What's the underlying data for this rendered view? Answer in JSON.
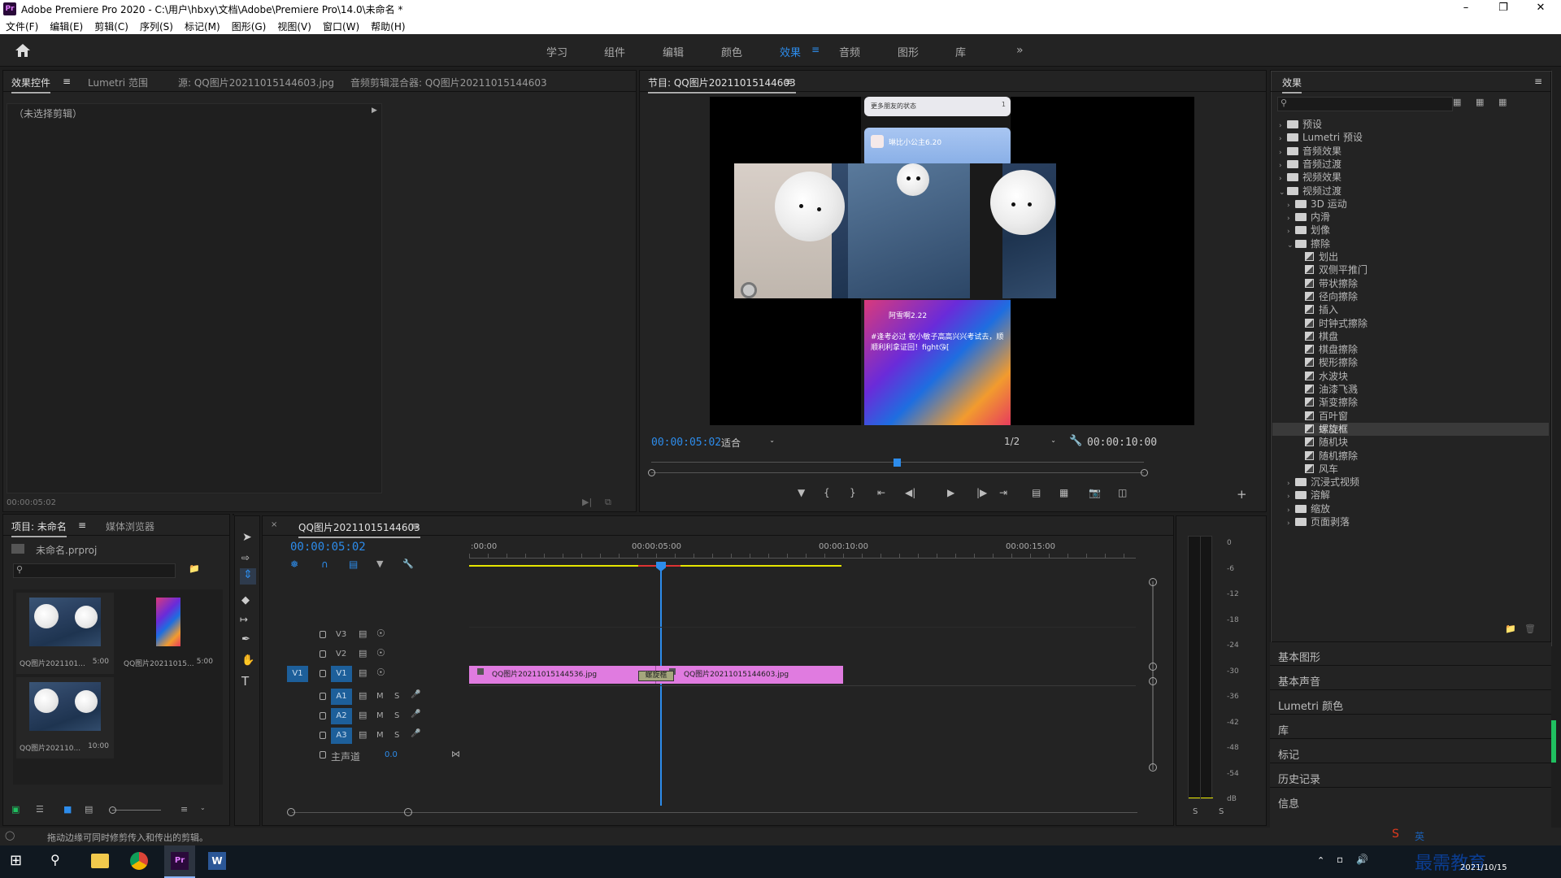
{
  "window": {
    "title": "Adobe Premiere Pro 2020 - C:\\用户\\hbxy\\文档\\Adobe\\Premiere Pro\\14.0\\未命名 *",
    "app_icon": "Pr"
  },
  "menu": [
    "文件(F)",
    "编辑(E)",
    "剪辑(C)",
    "序列(S)",
    "标记(M)",
    "图形(G)",
    "视图(V)",
    "窗口(W)",
    "帮助(H)"
  ],
  "workspaces": [
    "学习",
    "组件",
    "编辑",
    "颜色",
    "效果",
    "音频",
    "图形",
    "库"
  ],
  "workspace_active": "效果",
  "source_panel": {
    "tabs": [
      "效果控件",
      "Lumetri 范围",
      "源: QQ图片20211015144603.jpg",
      "音频剪辑混合器: QQ图片20211015144603"
    ],
    "no_clip": "（未选择剪辑）",
    "timecode": "00:00:05:02"
  },
  "program": {
    "tab": "节目: QQ图片20211015144603",
    "timecode": "00:00:05:02",
    "fit": "适合",
    "resolution": "1/2",
    "duration": "00:00:10:00",
    "overlay": {
      "more_friends": "更多朋友的状态",
      "more_count": "1",
      "friend_name": "琳比小公主6.20",
      "post_user": "阿雪啊2.22",
      "post_text": "#逢考必过  祝小敏子高高兴兴考试去，顺顺利利拿证回！fight😘["
    }
  },
  "effects_panel": {
    "title": "效果",
    "tree": [
      {
        "label": "预设",
        "type": "folder",
        "level": 0,
        "expanded": false
      },
      {
        "label": "Lumetri 预设",
        "type": "folder",
        "level": 0,
        "expanded": false
      },
      {
        "label": "音频效果",
        "type": "folder",
        "level": 0,
        "expanded": false
      },
      {
        "label": "音频过渡",
        "type": "folder",
        "level": 0,
        "expanded": false
      },
      {
        "label": "视频效果",
        "type": "folder",
        "level": 0,
        "expanded": false
      },
      {
        "label": "视频过渡",
        "type": "folder",
        "level": 0,
        "expanded": true
      },
      {
        "label": "3D 运动",
        "type": "folder",
        "level": 1,
        "expanded": false
      },
      {
        "label": "内滑",
        "type": "folder",
        "level": 1,
        "expanded": false
      },
      {
        "label": "划像",
        "type": "folder",
        "level": 1,
        "expanded": false
      },
      {
        "label": "擦除",
        "type": "folder",
        "level": 1,
        "expanded": true
      },
      {
        "label": "划出",
        "type": "fx",
        "level": 2
      },
      {
        "label": "双侧平推门",
        "type": "fx",
        "level": 2
      },
      {
        "label": "带状擦除",
        "type": "fx",
        "level": 2
      },
      {
        "label": "径向擦除",
        "type": "fx",
        "level": 2
      },
      {
        "label": "插入",
        "type": "fx",
        "level": 2
      },
      {
        "label": "时钟式擦除",
        "type": "fx",
        "level": 2
      },
      {
        "label": "棋盘",
        "type": "fx",
        "level": 2
      },
      {
        "label": "棋盘擦除",
        "type": "fx",
        "level": 2
      },
      {
        "label": "楔形擦除",
        "type": "fx",
        "level": 2
      },
      {
        "label": "水波块",
        "type": "fx",
        "level": 2
      },
      {
        "label": "油漆飞溅",
        "type": "fx",
        "level": 2
      },
      {
        "label": "渐变擦除",
        "type": "fx",
        "level": 2
      },
      {
        "label": "百叶窗",
        "type": "fx",
        "level": 2
      },
      {
        "label": "螺旋框",
        "type": "fx",
        "level": 2,
        "selected": true
      },
      {
        "label": "随机块",
        "type": "fx",
        "level": 2
      },
      {
        "label": "随机擦除",
        "type": "fx",
        "level": 2
      },
      {
        "label": "风车",
        "type": "fx",
        "level": 2
      },
      {
        "label": "沉浸式视频",
        "type": "folder",
        "level": 1,
        "expanded": false
      },
      {
        "label": "溶解",
        "type": "folder",
        "level": 1,
        "expanded": false
      },
      {
        "label": "缩放",
        "type": "folder",
        "level": 1,
        "expanded": false
      },
      {
        "label": "页面剥落",
        "type": "folder",
        "level": 1,
        "expanded": false
      }
    ]
  },
  "side_panels": [
    "基本图形",
    "基本声音",
    "Lumetri 颜色",
    "库",
    "标记",
    "历史记录",
    "信息"
  ],
  "project": {
    "tabs": [
      "项目: 未命名",
      "媒体浏览器"
    ],
    "file": "未命名.prproj",
    "items": [
      {
        "name": "QQ图片2021101...",
        "duration": "5:00"
      },
      {
        "name": "QQ图片20211015...",
        "duration": "5:00"
      },
      {
        "name": "QQ图片202110...",
        "duration": "10:00"
      }
    ]
  },
  "timeline": {
    "tab": "QQ图片20211015144603",
    "timecode": "00:00:05:02",
    "ruler": [
      ":00:00",
      "00:00:05:00",
      "00:00:10:00",
      "00:00:15:00"
    ],
    "tracks_video": [
      "V3",
      "V2",
      "V1"
    ],
    "tracks_audio": [
      "A1",
      "A2",
      "A3"
    ],
    "master": "主声道",
    "master_value": "0.0",
    "source_target": "V1",
    "clips": [
      {
        "name": "QQ图片20211015144536.jpg"
      },
      {
        "name": "QQ图片20211015144603.jpg"
      }
    ],
    "transition": "螺旋框"
  },
  "meter_labels": [
    "0",
    "-6",
    "-12",
    "-18",
    "-24",
    "-30",
    "-36",
    "-42",
    "-48",
    "-54",
    "dB"
  ],
  "meter_solo": [
    "S",
    "S"
  ],
  "status_text": "拖动边缘可同时修剪传入和传出的剪辑。",
  "taskbar": {
    "date": "2021/10/15",
    "watermark": "最需教育",
    "ime": "英"
  },
  "colors": {
    "accent": "#2d8ceb",
    "clip": "#e07be0",
    "selection_bar": "#e5e500"
  }
}
